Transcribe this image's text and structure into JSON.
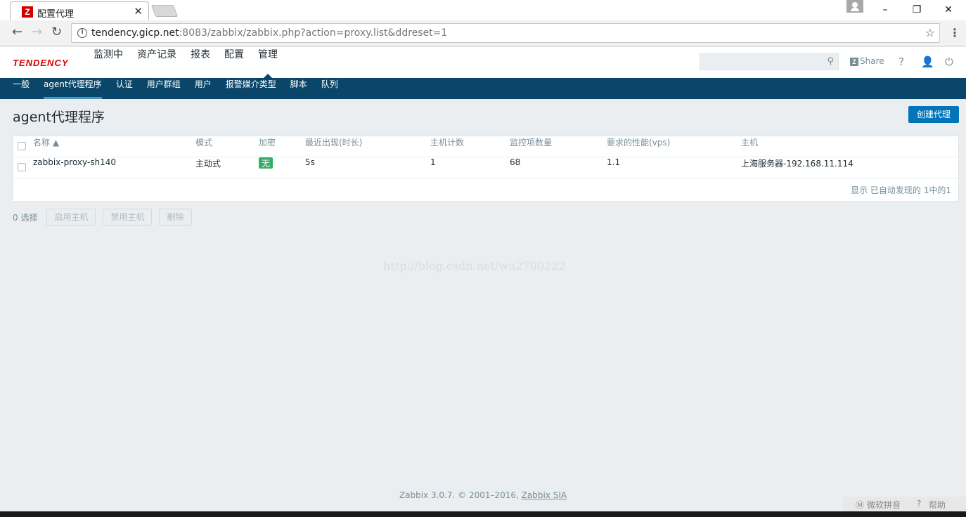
{
  "browser": {
    "tab_title": "配置代理",
    "favicon_letter": "Z",
    "url_host": "tendency.gicp.net",
    "url_rest": ":8083/zabbix/zabbix.php?action=proxy.list&ddreset=1"
  },
  "header": {
    "logo": "TENDENCY",
    "menu": [
      {
        "label": "监测中"
      },
      {
        "label": "资产记录"
      },
      {
        "label": "报表"
      },
      {
        "label": "配置"
      },
      {
        "label": "管理"
      }
    ],
    "share_label": "Share",
    "help_icon": "?"
  },
  "subnav": [
    {
      "label": "一般"
    },
    {
      "label": "agent代理程序"
    },
    {
      "label": "认证"
    },
    {
      "label": "用户群组"
    },
    {
      "label": "用户"
    },
    {
      "label": "报警媒介类型"
    },
    {
      "label": "脚本"
    },
    {
      "label": "队列"
    }
  ],
  "page": {
    "title": "agent代理程序",
    "create_button": "创建代理"
  },
  "table": {
    "columns": [
      "名称 ▲",
      "模式",
      "加密",
      "最近出现(时长)",
      "主机计数",
      "监控项数量",
      "要求的性能(vps)",
      "主机"
    ],
    "rows": [
      {
        "name": "zabbix-proxy-sh140",
        "mode": "主动式",
        "encryption": "无",
        "last_seen": "5s",
        "host_count": "1",
        "item_count": "68",
        "vps": "1.1",
        "hosts": "上海服务器-192.168.11.114"
      }
    ],
    "paging": "显示 已自动发现的 1中的1"
  },
  "actions": {
    "selected": "0 选择",
    "enable": "启用主机",
    "disable": "禁用主机",
    "delete": "删除"
  },
  "watermark": "http://blog.csdn.net/wu2700222",
  "footer": {
    "text": "Zabbix 3.0.7. © 2001–2016, ",
    "link": "Zabbix SIA"
  },
  "ime": {
    "ime_name": "微软拼音",
    "help": "帮助"
  }
}
